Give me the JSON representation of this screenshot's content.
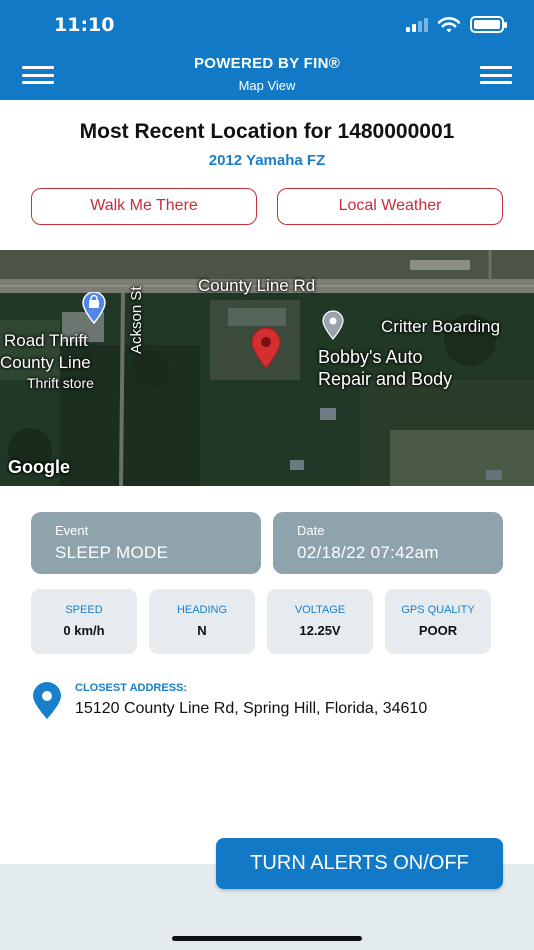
{
  "status_bar": {
    "time": "11:10"
  },
  "nav": {
    "title": "POWERED BY FIN®",
    "subtitle": "Map View"
  },
  "location": {
    "heading": "Most Recent Location for 1480000001",
    "vehicle": "2012 Yamaha FZ"
  },
  "actions": {
    "walk_label": "Walk Me There",
    "weather_label": "Local Weather"
  },
  "map": {
    "road_label": "County Line Rd",
    "side_street": "Ackson St",
    "poi_thrift_line1": "Road Thrift",
    "poi_thrift_line2": "County Line",
    "poi_thrift_category": "Thrift store",
    "poi_boarding": "Critter Boarding",
    "poi_auto_line1": "Bobby's Auto",
    "poi_auto_line2": "Repair and Body",
    "attribution": "Google",
    "marker_color": "#d32f2f"
  },
  "event": {
    "label": "Event",
    "value": "SLEEP MODE"
  },
  "date": {
    "label": "Date",
    "value": "02/18/22 07:42am"
  },
  "stats": [
    {
      "label": "SPEED",
      "value": "0 km/h"
    },
    {
      "label": "HEADING",
      "value": "N"
    },
    {
      "label": "VOLTAGE",
      "value": "12.25V"
    },
    {
      "label": "GPS QUALITY",
      "value": "POOR"
    }
  ],
  "address": {
    "label": "CLOSEST ADDRESS:",
    "value": "15120 County Line Rd, Spring Hill, Florida, 34610"
  },
  "alerts_button_label": "TURN ALERTS ON/OFF",
  "colors": {
    "brand_blue": "#1279c7",
    "accent_red": "#c62f3a",
    "card_gray": "#8fa3ad"
  }
}
